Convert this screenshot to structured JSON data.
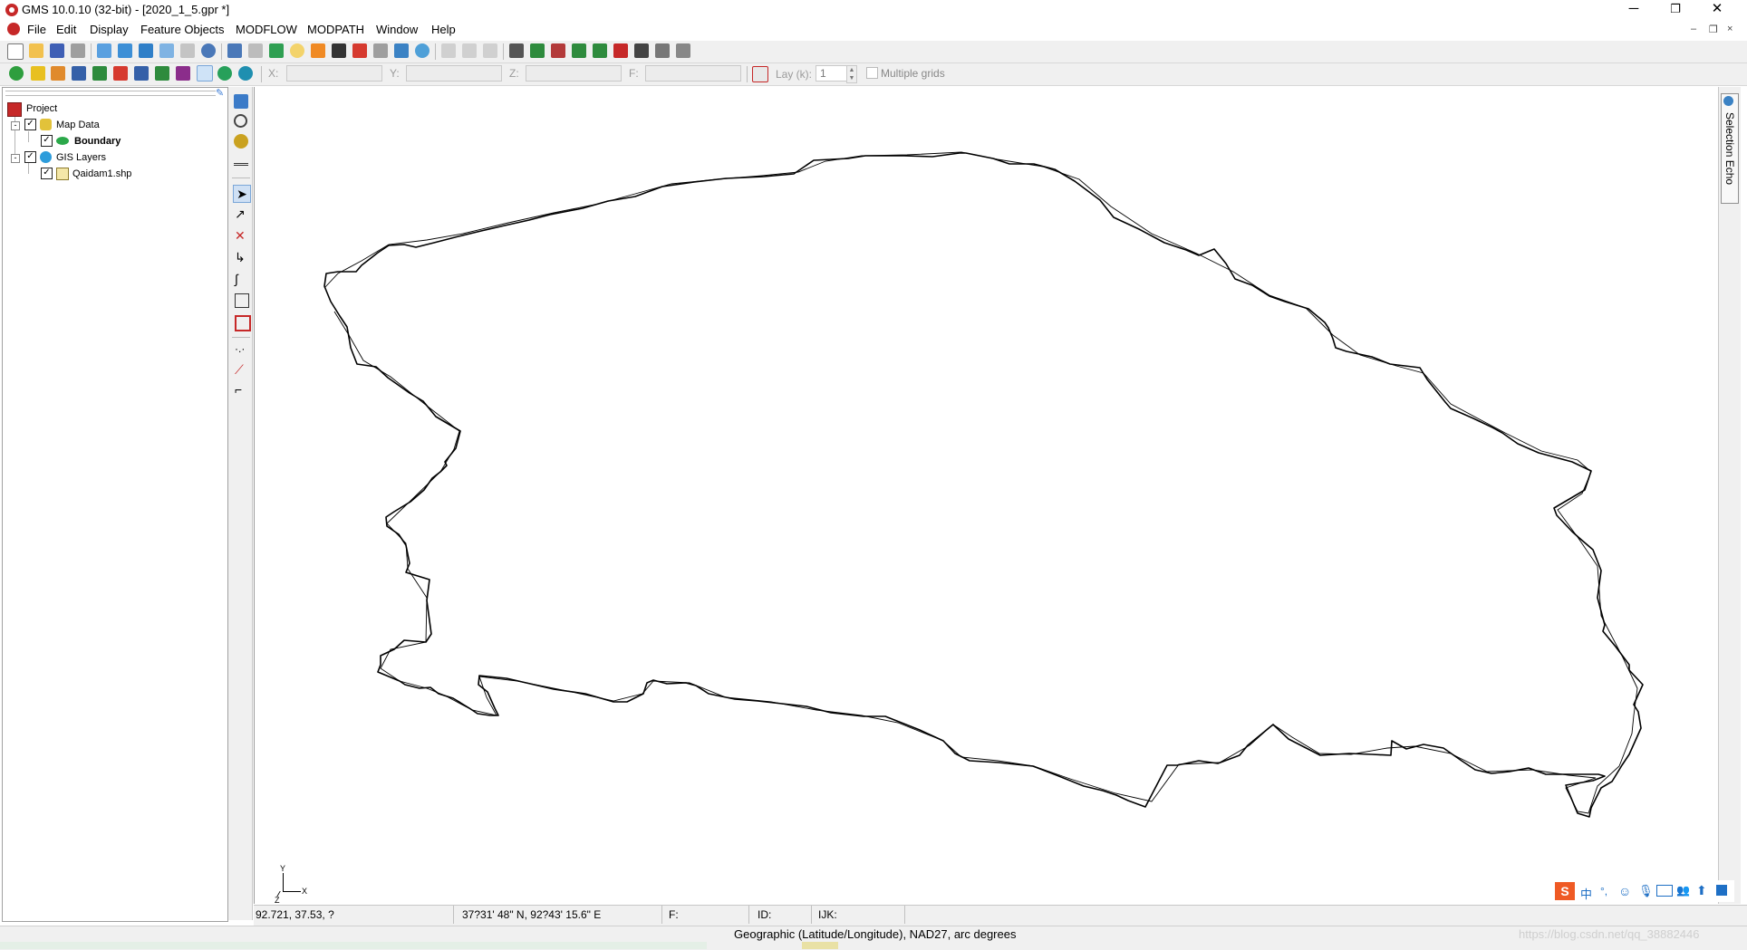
{
  "window": {
    "title": "GMS 10.0.10 (32-bit) - [2020_1_5.gpr *]",
    "minimize": "─",
    "restore": "❐",
    "close": "✕"
  },
  "menu": {
    "items": [
      "File",
      "Edit",
      "Display",
      "Feature Objects",
      "MODFLOW",
      "MODPATH",
      "Window",
      "Help"
    ],
    "mdi_buttons": [
      "–",
      "❐",
      "×"
    ]
  },
  "coord_toolbar": {
    "x_label": "X:",
    "y_label": "Y:",
    "z_label": "Z:",
    "f_label": "F:",
    "x_value": "",
    "y_value": "",
    "z_value": "",
    "f_value": "",
    "lay_label": "Lay (k):",
    "lay_value": "1",
    "multiple_grids_label": "Multiple grids"
  },
  "project_tree": {
    "root": "Project",
    "map_data": "Map Data",
    "boundary": "Boundary",
    "gis_layers": "GIS Layers",
    "shapefile": "Qaidam1.shp"
  },
  "axis_triad": {
    "y": "Y",
    "x": "X",
    "z": "Z"
  },
  "right_dock": {
    "selection_echo": "Selection Echo"
  },
  "status": {
    "cursor_xy": "92.721, 37.53, ?",
    "cursor_geo": "37?31' 48\" N, 92?43' 15.6\" E",
    "f_label": "F:",
    "id_label": "ID:",
    "ijk_label": "IJK:",
    "projection": "Geographic (Latitude/Longitude),  NAD27,  arc degrees",
    "watermark": "https://blog.csdn.net/qq_38882446"
  },
  "ime": {
    "logo": "S",
    "lang": "中"
  },
  "colors": {
    "app_red": "#c62828",
    "toolbar_bg": "#f0f0f0",
    "boundary_line": "#000000"
  }
}
